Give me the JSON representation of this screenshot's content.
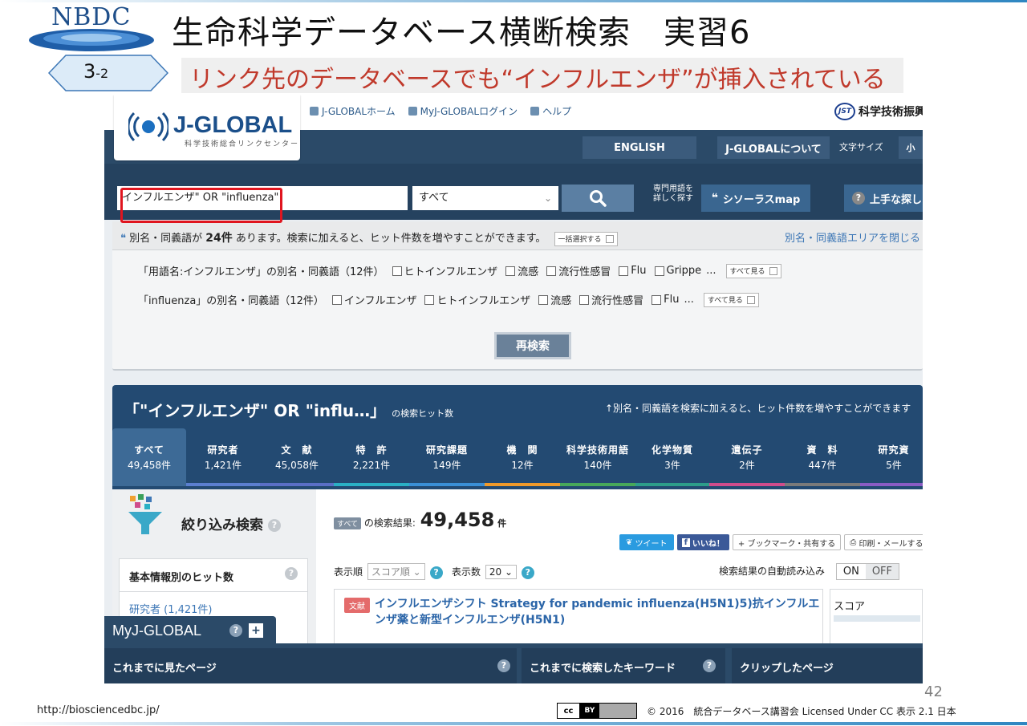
{
  "slide": {
    "logo_text": "NBDC",
    "title": "生命科学データベース横断検索　実習6",
    "step_main": "3",
    "step_sub": "-2",
    "subtitle": "リンク先のデータベースでも“インフルエンザ”が挿入されている",
    "footer_url": "http://biosciencedbc.jp/",
    "page_number": "42",
    "cc_label": "cc",
    "cc_by": "BY",
    "license": "© 2016　統合データベース講習会 Licensed Under CC 表示 2.1 日本"
  },
  "jglobal": {
    "logo_name": "J-GLOBAL",
    "logo_tagline": "科学技術総合リンクセンター",
    "top_links": [
      "J-GLOBALホーム",
      "MyJ-GLOBALログイン",
      "ヘルプ"
    ],
    "jst_mark": "JST",
    "jst_name": "科学技術振興",
    "nav": {
      "english": "ENGLISH",
      "about": "J-GLOBALについて",
      "font_size_label": "文字サイズ",
      "font_size_value": "小"
    },
    "search": {
      "query": "インフルエンザ\" OR \"influenza\"",
      "scope": "すべて",
      "term_label_1": "専門用語を",
      "term_label_2": "詳しく探す",
      "thesaurus": "シソーラスmap",
      "tips": "上手な探し"
    },
    "synonyms": {
      "message_pre": "別名・同義語が ",
      "count": "24件",
      "message_post": " あります。検索に加えると、ヒット件数を増やすことができます。",
      "select_all": "一括選択する",
      "close_link": "別名・同義語エリアを閉じる",
      "row1_label": "「用語名:インフルエンザ」の別名・同義語（12件）",
      "row1_terms": [
        "ヒトインフルエンザ",
        "流感",
        "流行性感冒",
        "Flu",
        "Grippe"
      ],
      "row2_label": "「influenza」の別名・同義語（12件）",
      "row2_terms": [
        "インフルエンザ",
        "ヒトインフルエンザ",
        "流感",
        "流行性感冒",
        "Flu"
      ],
      "ellipsis": "...",
      "see_all": "すべて見る",
      "research": "再検索"
    },
    "hits": {
      "title": "「\"インフルエンザ\" OR \"influ…」",
      "title_suffix": "の検索ヒット数",
      "note": "↑別名・同義語を検索に加えると、ヒット件数を増やすことができます",
      "categories": [
        {
          "label": "すべて",
          "count": "49,458件",
          "color": "#3d6a96"
        },
        {
          "label": "研究者",
          "count": "1,421件",
          "color": "#5b7fd0"
        },
        {
          "label": "文　献",
          "count": "45,058件",
          "color": "#5a6fc6"
        },
        {
          "label": "特　許",
          "count": "2,221件",
          "color": "#2ab0c5"
        },
        {
          "label": "研究課題",
          "count": "149件",
          "color": "#3a8fd6"
        },
        {
          "label": "機　関",
          "count": "12件",
          "color": "#f09a2a"
        },
        {
          "label": "科学技術用語",
          "count": "140件",
          "color": "#47a85a"
        },
        {
          "label": "化学物質",
          "count": "3件",
          "color": "#2d9d8a"
        },
        {
          "label": "遺伝子",
          "count": "2件",
          "color": "#d04c8c"
        },
        {
          "label": "資　料",
          "count": "447件",
          "color": "#7a7a7a"
        },
        {
          "label": "研究資",
          "count": "5件",
          "color": "#8a5cc4"
        }
      ]
    },
    "filter": {
      "title": "絞り込み検索",
      "box_title": "基本情報別のヒット数",
      "researcher_link": "研究者 (1,421件)"
    },
    "results": {
      "all_tag": "すべて",
      "label": "の検索結果:",
      "count": "49,458",
      "unit": "件",
      "tweet": "ツイート",
      "like": "いいね！",
      "bookmark": "+ ブックマーク・共有する",
      "print": "印刷・メールする",
      "sort_label": "表示順",
      "sort_value": "スコア順",
      "per_page_label": "表示数",
      "per_page_value": "20",
      "autoload_label": "検索結果の自動読み込み",
      "on": "ON",
      "off": "OFF",
      "item_type": "文献",
      "item_title": "インフルエンザシフト  Strategy for pandemic influenza(H5N1)5)抗インフルエンザ薬と新型インフルエンザ(H5N1)",
      "score_label": "スコア"
    },
    "myjglobal": {
      "title": "MyJ-GLOBAL",
      "plus": "+",
      "sections": [
        "これまでに見たページ",
        "これまでに検索したキーワード",
        "クリップしたページ"
      ]
    }
  }
}
